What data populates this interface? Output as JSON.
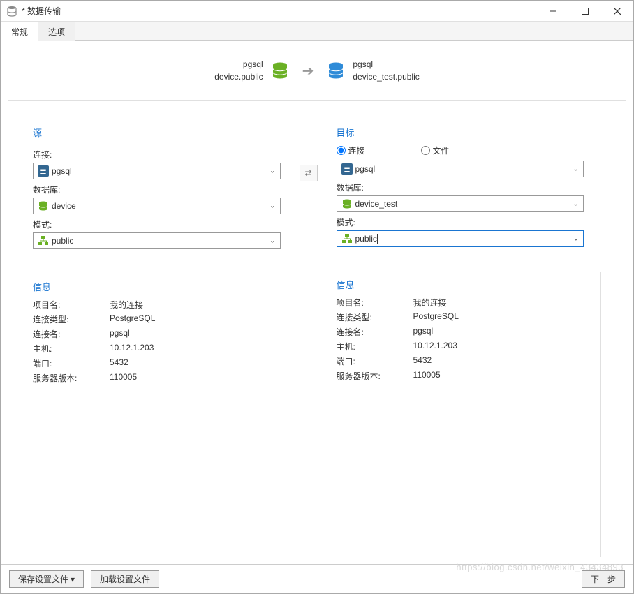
{
  "window": {
    "title": "* 数据传输"
  },
  "tabs": {
    "general": "常规",
    "options": "选项"
  },
  "summary": {
    "src_name": "pgsql",
    "src_path": "device.public",
    "dst_name": "pgsql",
    "dst_path": "device_test.public"
  },
  "labels": {
    "source": "源",
    "target": "目标",
    "connection": "连接:",
    "file": "文件",
    "database": "数据库:",
    "schema": "模式:",
    "info": "信息",
    "project_name": "项目名:",
    "conn_type": "连接类型:",
    "conn_name": "连接名:",
    "host": "主机:",
    "port": "端口:",
    "server_version": "服务器版本:"
  },
  "source": {
    "connection": "pgsql",
    "database": "device",
    "schema": "public",
    "info": {
      "project_name": "我的连接",
      "conn_type": "PostgreSQL",
      "conn_name": "pgsql",
      "host": "10.12.1.203",
      "port": "5432",
      "server_version": "110005"
    }
  },
  "target": {
    "conn_radio": "连接",
    "file_radio": "文件",
    "connection": "pgsql",
    "database": "device_test",
    "schema": "public",
    "info": {
      "project_name": "我的连接",
      "conn_type": "PostgreSQL",
      "conn_name": "pgsql",
      "host": "10.12.1.203",
      "port": "5432",
      "server_version": "110005"
    }
  },
  "footer": {
    "save_profile": "保存设置文件",
    "load_profile": "加载设置文件",
    "next": "下一步"
  },
  "watermark": "https://blog.csdn.net/weixin_43434893"
}
